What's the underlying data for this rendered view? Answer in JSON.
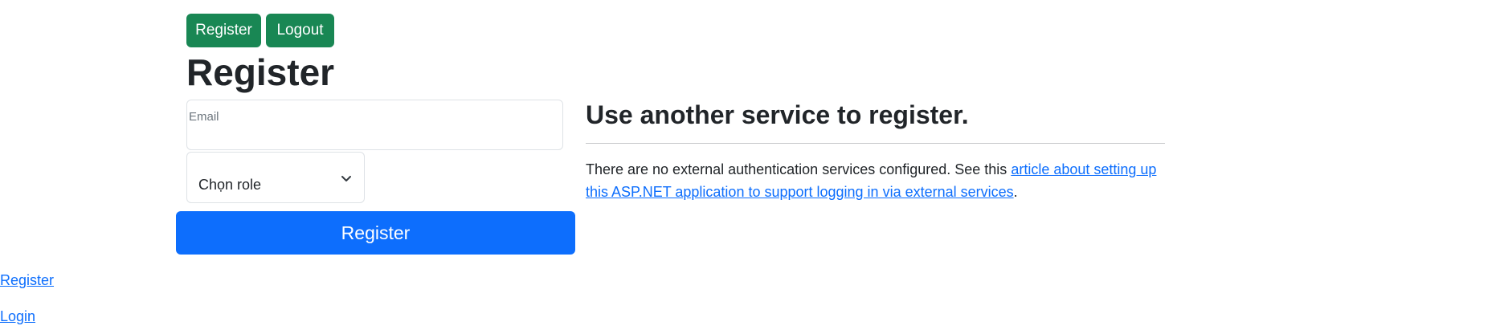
{
  "nav": {
    "register_label": "Register",
    "logout_label": "Logout"
  },
  "form": {
    "title": "Register",
    "email_label": "Email",
    "email_value": "",
    "role_selected": "Chọn role",
    "submit_label": "Register"
  },
  "external": {
    "heading": "Use another service to register.",
    "text_before": "There are no external authentication services configured. See this ",
    "link_text": "article about setting up this ASP.NET application to support logging in via external services",
    "text_after": "."
  },
  "footer": {
    "register_link": "Register",
    "login_link": "Login"
  },
  "colors": {
    "success": "#198754",
    "primary": "#0d6efd",
    "text": "#212529"
  },
  "icons": {
    "select_chevron": "chevron-down-icon"
  }
}
